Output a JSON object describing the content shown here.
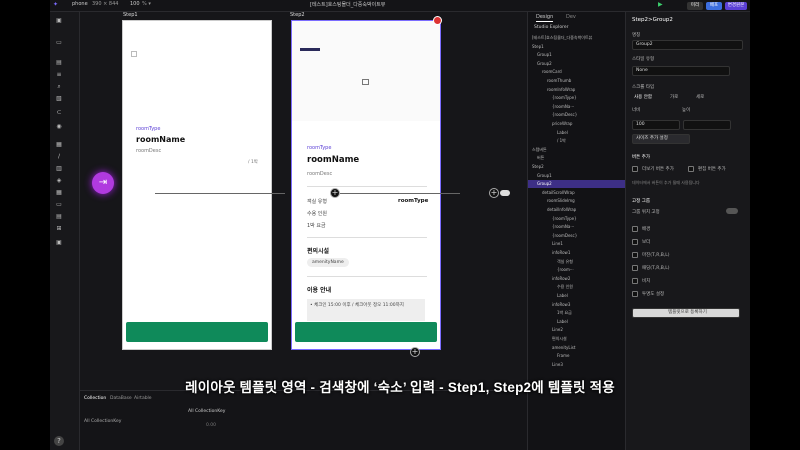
{
  "topbar": {
    "device": "phone",
    "size": "390 × 844",
    "zoom": "100",
    "title": "[테스트]호스팅몰더_다중숙박이트뷰",
    "preview_label": "미리",
    "publish_label": "배포",
    "save_label": "변경원본"
  },
  "canvas": {
    "step1_title": "Step1",
    "step2_title": "Step2",
    "step1": {
      "room_type": "roomType",
      "room_name": "roomName",
      "room_desc": "roomDesc",
      "price": "/ 1박"
    },
    "step2": {
      "room_type": "roomType",
      "room_name": "roomName",
      "room_desc": "roomDesc",
      "info_rows": [
        {
          "label": "객실 유형",
          "value": "roomType"
        },
        {
          "label": "수용 인원",
          "value": ""
        },
        {
          "label": "1박 요금",
          "value": ""
        }
      ],
      "amenity_title": "편의시설",
      "amenity_chip": "amenityName",
      "usage_title": "이용 안내",
      "usage_text": "• 체크인 15:00 이후 / 체크아웃 정오 11:00까지"
    }
  },
  "bottom_panel": {
    "tabs": [
      "Collection",
      "DataBase",
      "Airtable"
    ],
    "left_item": "All CollectionKey",
    "right_item": "All CollectionKey",
    "value": "0.00"
  },
  "explorer": {
    "tabs": [
      "Design",
      "Dev"
    ],
    "header": "Studio Explorer",
    "items": [
      {
        "label": "[테스트]호스팅몰더_다중숙박이트뷰",
        "indent": 0,
        "selected": false
      },
      {
        "label": "Step1",
        "indent": 0,
        "selected": false
      },
      {
        "label": "Group1",
        "indent": 1,
        "selected": false
      },
      {
        "label": "Group2",
        "indent": 1,
        "selected": false
      },
      {
        "label": "roomCard",
        "indent": 2,
        "selected": false
      },
      {
        "label": "roomThumb",
        "indent": 3,
        "selected": false
      },
      {
        "label": "roomInfoWrap",
        "indent": 3,
        "selected": false
      },
      {
        "label": "{roomType}",
        "indent": 4,
        "selected": false
      },
      {
        "label": "{roomNa···",
        "indent": 4,
        "selected": false
      },
      {
        "label": "{roomDesc}",
        "indent": 4,
        "selected": false
      },
      {
        "label": "priceWrap",
        "indent": 4,
        "selected": false
      },
      {
        "label": "Label",
        "indent": 5,
        "selected": false
      },
      {
        "label": "/ 1박",
        "indent": 5,
        "selected": false
      },
      {
        "label": "스텝버튼",
        "indent": 0,
        "selected": false
      },
      {
        "label": "버튼",
        "indent": 1,
        "selected": false
      },
      {
        "label": "Step2",
        "indent": 0,
        "selected": false
      },
      {
        "label": "Group1",
        "indent": 1,
        "selected": false
      },
      {
        "label": "Group2",
        "indent": 1,
        "selected": true
      },
      {
        "label": "detailScrollWrap",
        "indent": 2,
        "selected": false
      },
      {
        "label": "roomSlideImg",
        "indent": 3,
        "selected": false
      },
      {
        "label": "detailInfoWrap",
        "indent": 3,
        "selected": false
      },
      {
        "label": "{roomType}",
        "indent": 4,
        "selected": false
      },
      {
        "label": "{roomNa···",
        "indent": 4,
        "selected": false
      },
      {
        "label": "{roomDesc}",
        "indent": 4,
        "selected": false
      },
      {
        "label": "Line1",
        "indent": 4,
        "selected": false
      },
      {
        "label": "infoRow1",
        "indent": 4,
        "selected": false
      },
      {
        "label": "객실 유형",
        "indent": 5,
        "selected": false
      },
      {
        "label": "{room···",
        "indent": 5,
        "selected": false
      },
      {
        "label": "infoRow2",
        "indent": 4,
        "selected": false
      },
      {
        "label": "수용 인원",
        "indent": 5,
        "selected": false
      },
      {
        "label": "Label",
        "indent": 5,
        "selected": false
      },
      {
        "label": "infoRow3",
        "indent": 4,
        "selected": false
      },
      {
        "label": "1박 요금",
        "indent": 5,
        "selected": false
      },
      {
        "label": "Label",
        "indent": 5,
        "selected": false
      },
      {
        "label": "Line2",
        "indent": 4,
        "selected": false
      },
      {
        "label": "편의시설",
        "indent": 4,
        "selected": false
      },
      {
        "label": "amenityList",
        "indent": 4,
        "selected": false
      },
      {
        "label": "Frame",
        "indent": 5,
        "selected": false
      },
      {
        "label": "Line3",
        "indent": 4,
        "selected": false
      }
    ]
  },
  "props": {
    "title": "Step2>Group2",
    "name_label": "명칭",
    "name_value": "Group2",
    "style_label": "스타일 유형",
    "style_value": "None",
    "scroll_label": "스크롤 타입",
    "radio_options": [
      "사용 안함",
      "가로",
      "세로"
    ],
    "width_label": "너비",
    "height_label": "높이",
    "width_value": "100",
    "size_button": "사이즈 추가 설정",
    "button_section": "버튼 추가",
    "btn_opt1": "더보기 버튼 추가",
    "btn_opt2": "편집 버튼 추가",
    "note": "데이터에서 버튼이 추가 될때 사용됩니다",
    "fixed_section": "고정 그룹",
    "fixed_toggle_label": "그룹 위치 고정",
    "check_items": [
      "배경",
      "보더",
      "마진(T,R,B,L)",
      "패딩(T,R,B,L)",
      "비치",
      "투명도 설정"
    ],
    "bottom_button": "템플릿으로 등록하기"
  },
  "subtitle": "레이아웃 템플릿 영역 - 검색창에 ‘숙소’ 입력 - Step1, Step2에 템플릿 적용",
  "colors": {
    "accent": "#5b3fd6",
    "green": "#0f8a5a",
    "pin": "#b03adf"
  }
}
